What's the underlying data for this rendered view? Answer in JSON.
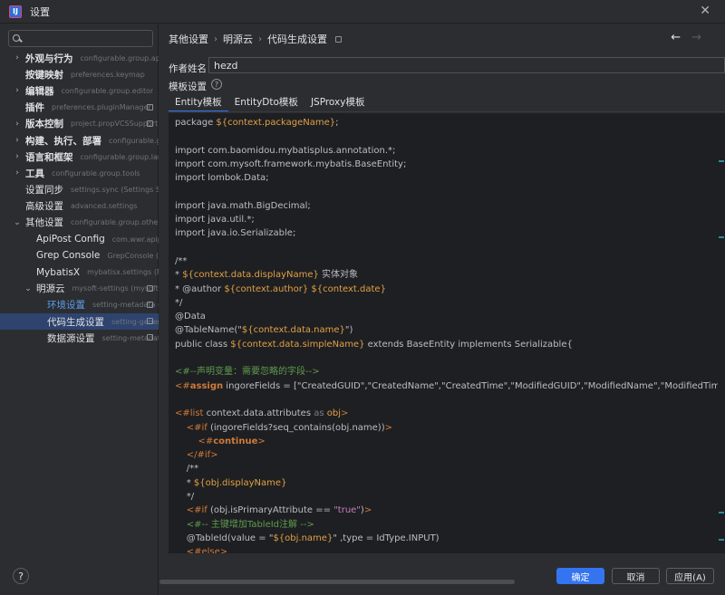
{
  "window": {
    "title": "设置",
    "logo_text": "IJ",
    "close": "✕"
  },
  "search": {
    "value": "",
    "placeholder": ""
  },
  "sidebar": {
    "items": [
      {
        "label": "外观与行为",
        "sub": "configurable.group.appea",
        "arrow": "›",
        "bold": true
      },
      {
        "label": "按键映射",
        "sub": "preferences.keymap",
        "arrow": "",
        "bold": true
      },
      {
        "label": "编辑器",
        "sub": "configurable.group.editor",
        "arrow": "›",
        "bold": true
      },
      {
        "label": "插件",
        "sub": "preferences.pluginManager",
        "arrow": "",
        "bold": true
      },
      {
        "label": "版本控制",
        "sub": "project.propVCSSupport.",
        "arrow": "›",
        "bold": true
      },
      {
        "label": "构建、执行、部署",
        "sub": "configurable.group",
        "arrow": "›",
        "bold": true
      },
      {
        "label": "语言和框架",
        "sub": "configurable.group.langu",
        "arrow": "›",
        "bold": true
      },
      {
        "label": "工具",
        "sub": "configurable.group.tools",
        "arrow": "›",
        "bold": true
      },
      {
        "label": "设置同步",
        "sub": "settings.sync (Settings Sync",
        "arrow": "",
        "bold": false
      },
      {
        "label": "高级设置",
        "sub": "advanced.settings",
        "arrow": "",
        "bold": false
      },
      {
        "label": "其他设置",
        "sub": "configurable.group.other",
        "arrow": "⌄",
        "bold": false
      },
      {
        "label": "ApiPost Config",
        "sub": "com.wwr.apipost",
        "arrow": "",
        "bold": false
      },
      {
        "label": "Grep Console",
        "sub": "GrepConsole (Grep",
        "arrow": "",
        "bold": false
      },
      {
        "label": "MybatisX",
        "sub": "mybatisx.settings (MyBa",
        "arrow": "",
        "bold": false
      },
      {
        "label": "明源云",
        "sub": "mysoft-settings (mysoft",
        "arrow": "⌄",
        "bold": false
      },
      {
        "label": "环境设置",
        "sub": "setting-metadata (",
        "arrow": "",
        "bold": false
      },
      {
        "label": "代码生成设置",
        "sub": "setting-gener",
        "arrow": "",
        "bold": false
      },
      {
        "label": "数据源设置",
        "sub": "setting-metadat",
        "arrow": "",
        "bold": false
      }
    ]
  },
  "help": "?",
  "breadcrumb": {
    "items": [
      "其他设置",
      "明源云",
      "代码生成设置"
    ],
    "sep": "›"
  },
  "nav": {
    "back": "←",
    "forward": "→"
  },
  "form": {
    "author_label": "作者姓名",
    "author_value": "hezd",
    "template_label": "模板设置",
    "help_icon": "?"
  },
  "tabs": [
    "Entity模板",
    "EntityDto模板",
    "JSProxy模板"
  ],
  "code": [
    [
      [
        "def",
        "package "
      ],
      [
        "var",
        "${context.packageName}"
      ],
      [
        "def",
        ";"
      ]
    ],
    [],
    [
      [
        "def",
        "import com.baomidou.mybatisplus.annotation.*;"
      ]
    ],
    [
      [
        "def",
        "import com.mysoft.framework.mybatis.BaseEntity;"
      ]
    ],
    [
      [
        "def",
        "import lombok.Data;"
      ]
    ],
    [],
    [
      [
        "def",
        "import java.math.BigDecimal;"
      ]
    ],
    [
      [
        "def",
        "import java.util.*;"
      ]
    ],
    [
      [
        "def",
        "import java.io.Serializable;"
      ]
    ],
    [],
    [
      [
        "def",
        "/**"
      ]
    ],
    [
      [
        "def",
        "* "
      ],
      [
        "var",
        "${context.data.displayName}"
      ],
      [
        "def",
        " 实体对象"
      ]
    ],
    [
      [
        "def",
        "* @author "
      ],
      [
        "var",
        "${context.author}"
      ],
      [
        "def",
        " "
      ],
      [
        "var",
        "${context.date}"
      ]
    ],
    [
      [
        "def",
        "*/"
      ]
    ],
    [
      [
        "def",
        "@Data"
      ]
    ],
    [
      [
        "def",
        "@TableName(\""
      ],
      [
        "var",
        "${context.data.name}"
      ],
      [
        "def",
        "\")"
      ]
    ],
    [
      [
        "def",
        "public class "
      ],
      [
        "var",
        "${context.data.simpleName}"
      ],
      [
        "def",
        " extends BaseEntity implements Serializable{"
      ]
    ],
    [],
    [
      [
        "cmt",
        "<#--声明变量：需要忽略的字段-->"
      ]
    ],
    [
      [
        "dir",
        "<#"
      ],
      [
        "kw",
        "assign"
      ],
      [
        "def",
        " ingoreFields = [\"CreatedGUID\",\"CreatedName\",\"CreatedTime\",\"ModifiedGUID\",\"ModifiedName\",\"ModifiedTime\",\"VersionNumber\""
      ]
    ],
    [],
    [
      [
        "dir",
        "<#list"
      ],
      [
        "def",
        " context.data.attributes "
      ],
      [
        "gray",
        "as"
      ],
      [
        "def",
        " "
      ],
      [
        "var",
        "obj"
      ],
      [
        "dir",
        ">"
      ]
    ],
    [
      [
        "def",
        "    "
      ],
      [
        "dir",
        "<#if"
      ],
      [
        "def",
        " (ingoreFields?seq_contains(obj.name))"
      ],
      [
        "dir",
        ">"
      ]
    ],
    [
      [
        "def",
        "        "
      ],
      [
        "dir",
        "<#"
      ],
      [
        "kw",
        "continue"
      ],
      [
        "dir",
        ">"
      ]
    ],
    [
      [
        "def",
        "    "
      ],
      [
        "dir",
        "</#if>"
      ]
    ],
    [
      [
        "def",
        "    /**"
      ]
    ],
    [
      [
        "def",
        "    * "
      ],
      [
        "var",
        "${obj.displayName}"
      ]
    ],
    [
      [
        "def",
        "    */"
      ]
    ],
    [
      [
        "def",
        "    "
      ],
      [
        "dir",
        "<#if"
      ],
      [
        "def",
        " (obj.isPrimaryAttribute == "
      ],
      [
        "str2",
        "\"true\""
      ],
      [
        "def",
        ")"
      ],
      [
        "dir",
        ">"
      ]
    ],
    [
      [
        "def",
        "    "
      ],
      [
        "cmt",
        "<#-- 主键增加TableId注解 -->"
      ]
    ],
    [
      [
        "def",
        "    @TableId(value = \""
      ],
      [
        "var",
        "${obj.name}"
      ],
      [
        "def",
        "\" ,type = IdType.INPUT)"
      ]
    ],
    [
      [
        "def",
        "    "
      ],
      [
        "dir",
        "<#else>"
      ]
    ]
  ],
  "buttons": {
    "ok": "确定",
    "cancel": "取消",
    "apply": "应用(A)"
  }
}
